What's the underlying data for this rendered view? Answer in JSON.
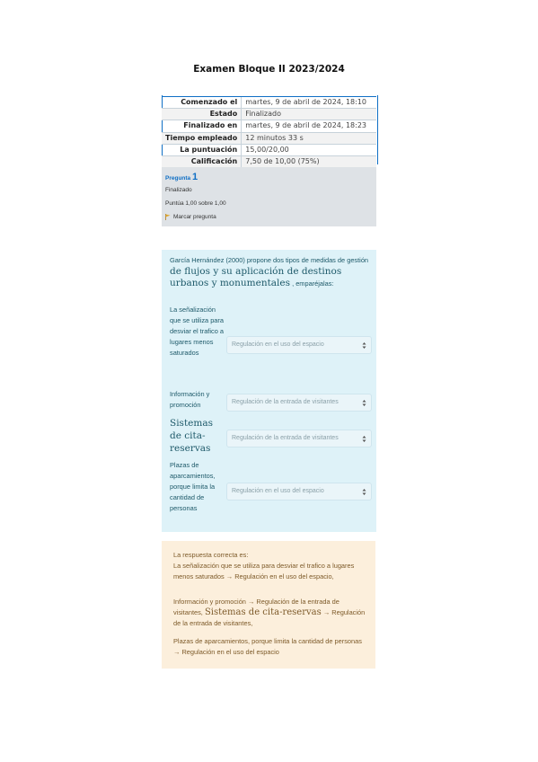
{
  "title": "Examen Bloque II 2023/2024",
  "summary": [
    {
      "label": "Comenzado el",
      "value": "martes, 9 de abril de 2024, 18:10"
    },
    {
      "label": "Estado",
      "value": "Finalizado"
    },
    {
      "label": "Finalizado en",
      "value": "martes, 9 de abril de 2024, 18:23"
    },
    {
      "label": "Tiempo empleado",
      "value": "12 minutos 33 s"
    },
    {
      "label": "La puntuación",
      "value": "15,00/20,00"
    },
    {
      "label": "Calificación",
      "value": "7,50 de 10,00 (75%)"
    }
  ],
  "question": {
    "label": "Pregunta",
    "number": "1",
    "status": "Finalizado",
    "score": "Puntúa 1,00 sobre 1,00",
    "flag": "Marcar pregunta"
  },
  "prompt": {
    "part1": "García Hernández (2000) propone dos tipos de medidas de gestión",
    "part2": "de flujos y su aplicación de destinos urbanos y monumentales",
    "part3": ", emparéjalas:"
  },
  "rows": [
    {
      "label": "La señalización que se utiliza para desviar el trafico a lugares menos saturados",
      "selected": "Regulación en el uso del espacio"
    },
    {
      "label": "Información y promoción",
      "selected": "Regulación de la entrada de visitantes"
    },
    {
      "label": "Sistemas de cita-reservas",
      "selected": "Regulación de la entrada de visitantes"
    },
    {
      "label": "Plazas de aparcamientos, porque limita la cantidad de personas",
      "selected": "Regulación en el uso del espacio"
    }
  ],
  "feedback": {
    "heading": "La respuesta correcta es:",
    "line1": "La señalización que se utiliza para desviar el trafico a lugares menos saturados → Regulación en el uso del espacio,",
    "line2a": "Información y promoción → Regulación de la entrada de visitantes,",
    "line2b": "Sistemas de cita-reservas",
    "line2c": "→ Regulación de la entrada de visitantes,",
    "line3": "Plazas de aparcamientos, porque limita la cantidad de personas → Regulación en el uso del espacio"
  }
}
